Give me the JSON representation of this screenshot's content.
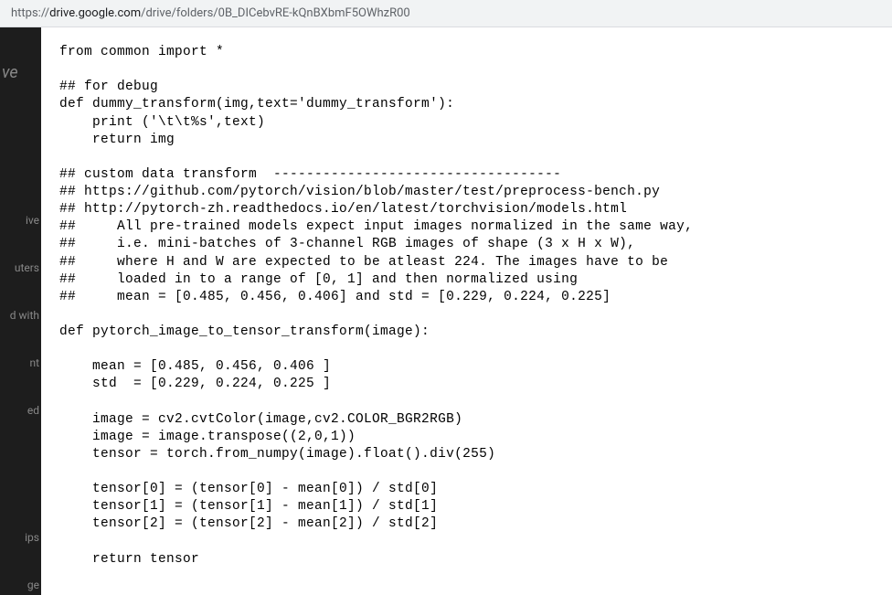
{
  "url": {
    "prefix": "https://",
    "domain": "drive.google.com",
    "path": "/drive/folders/0B_DICebvRE-kQnBXbmF5OWhzR00"
  },
  "sidebar": {
    "logo": "ve",
    "items": [
      "ive",
      "uters",
      "d with",
      "nt",
      "ed",
      "ips",
      "ge"
    ]
  },
  "code": {
    "content": "from common import *\n\n## for debug\ndef dummy_transform(img,text='dummy_transform'):\n    print ('\\t\\t%s',text)\n    return img\n\n## custom data transform  -----------------------------------\n## https://github.com/pytorch/vision/blob/master/test/preprocess-bench.py\n## http://pytorch-zh.readthedocs.io/en/latest/torchvision/models.html\n##     All pre-trained models expect input images normalized in the same way,\n##     i.e. mini-batches of 3-channel RGB images of shape (3 x H x W),\n##     where H and W are expected to be atleast 224. The images have to be\n##     loaded in to a range of [0, 1] and then normalized using\n##     mean = [0.485, 0.456, 0.406] and std = [0.229, 0.224, 0.225]\n\ndef pytorch_image_to_tensor_transform(image):\n\n    mean = [0.485, 0.456, 0.406 ]\n    std  = [0.229, 0.224, 0.225 ]\n\n    image = cv2.cvtColor(image,cv2.COLOR_BGR2RGB)\n    image = image.transpose((2,0,1))\n    tensor = torch.from_numpy(image).float().div(255)\n\n    tensor[0] = (tensor[0] - mean[0]) / std[0]\n    tensor[1] = (tensor[1] - mean[1]) / std[1]\n    tensor[2] = (tensor[2] - mean[2]) / std[2]\n\n    return tensor"
  }
}
